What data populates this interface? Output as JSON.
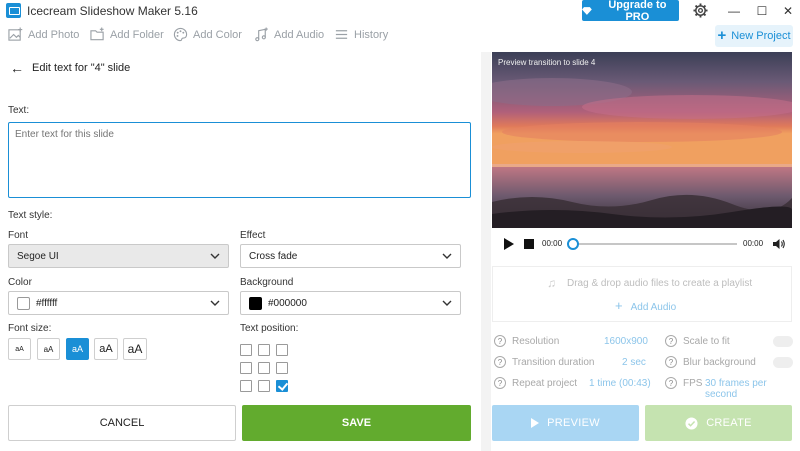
{
  "window": {
    "title": "Icecream Slideshow Maker 5.16",
    "upgrade_label": "Upgrade to PRO",
    "minimize": "—",
    "maximize": "☐",
    "close": "✕"
  },
  "toolbar": {
    "items": [
      {
        "label": "Add Photo",
        "icon": "add-photo-icon"
      },
      {
        "label": "Add Folder",
        "icon": "add-folder-icon"
      },
      {
        "label": "Add Color",
        "icon": "palette-icon"
      },
      {
        "label": "Add Audio",
        "icon": "add-audio-icon"
      },
      {
        "label": "History",
        "icon": "history-icon"
      }
    ],
    "new_project": "New Project"
  },
  "editor": {
    "back_label": "Edit text for \"4\" slide",
    "text_label": "Text:",
    "text_placeholder": "Enter text for this slide",
    "text_style_label": "Text style:",
    "font_label": "Font",
    "font_value": "Segoe UI",
    "effect_label": "Effect",
    "effect_value": "Cross fade",
    "color_label": "Color",
    "color_value": "#ffffff",
    "background_label": "Background",
    "background_value": "#000000",
    "font_size_label": "Font size:",
    "font_sizes": [
      "aA",
      "aA",
      "aA",
      "aA",
      "aA"
    ],
    "font_size_selected": 2,
    "text_position_label": "Text position:",
    "text_position_selected": 8,
    "cancel_label": "CANCEL",
    "save_label": "SAVE"
  },
  "preview": {
    "caption": "Preview transition to slide 4",
    "time_current": "00:00",
    "time_total": "00:00"
  },
  "audio": {
    "drop_text": "Drag & drop audio files to create a playlist",
    "add_label": "Add Audio"
  },
  "options": {
    "resolution_label": "Resolution",
    "resolution_value": "1600x900",
    "transition_label": "Transition duration",
    "transition_value": "2 sec",
    "repeat_label": "Repeat project",
    "repeat_value": "1 time (00:43)",
    "scale_label": "Scale to fit",
    "blur_label": "Blur background",
    "fps_label": "FPS",
    "fps_value": "30 frames per second"
  },
  "actions": {
    "preview_label": "PREVIEW",
    "create_label": "CREATE"
  },
  "colors": {
    "accent": "#1a8fd6",
    "save": "#62ab2e",
    "preview_disabled": "#a9d6f3",
    "create_disabled": "#c5e3b0"
  }
}
